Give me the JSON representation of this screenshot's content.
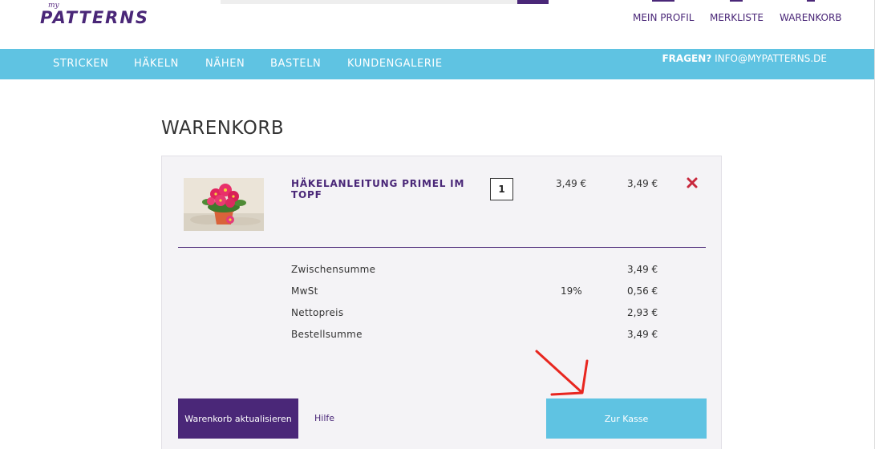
{
  "header": {
    "logo_small": "my",
    "logo_name": "PATTERNS",
    "links": [
      "MEIN PROFIL",
      "MERKLISTE",
      "WARENKORB"
    ]
  },
  "nav": {
    "items": [
      "STRICKEN",
      "HÄKELN",
      "NÄHEN",
      "BASTELN",
      "KUNDENGALERIE"
    ],
    "contact_label": "FRAGEN?",
    "contact_email": "INFO@MYPATTERNS.DE"
  },
  "cart": {
    "title": "WARENKORB",
    "item": {
      "name": "HÄKELANLEITUNG PRIMEL IM TOPF",
      "quantity": "1",
      "unit_price": "3,49 €",
      "total_price": "3,49 €",
      "remove_icon": "close-icon"
    },
    "summary": {
      "subtotal_label": "Zwischensumme",
      "subtotal_value": "3,49 €",
      "vat_label": "MwSt",
      "vat_rate": "19%",
      "vat_value": "0,56 €",
      "net_label": "Nettopreis",
      "net_value": "2,93 €",
      "total_label": "Bestellsumme",
      "total_value": "3,49 €"
    },
    "update_button": "Warenkorb aktualisieren",
    "help_link": "Hilfe",
    "checkout_button": "Zur Kasse"
  },
  "colors": {
    "brand_purple": "#4a2778",
    "nav_blue": "#5fc3e2",
    "remove_red": "#c8283c",
    "annotation_arrow": "#e8261f"
  }
}
